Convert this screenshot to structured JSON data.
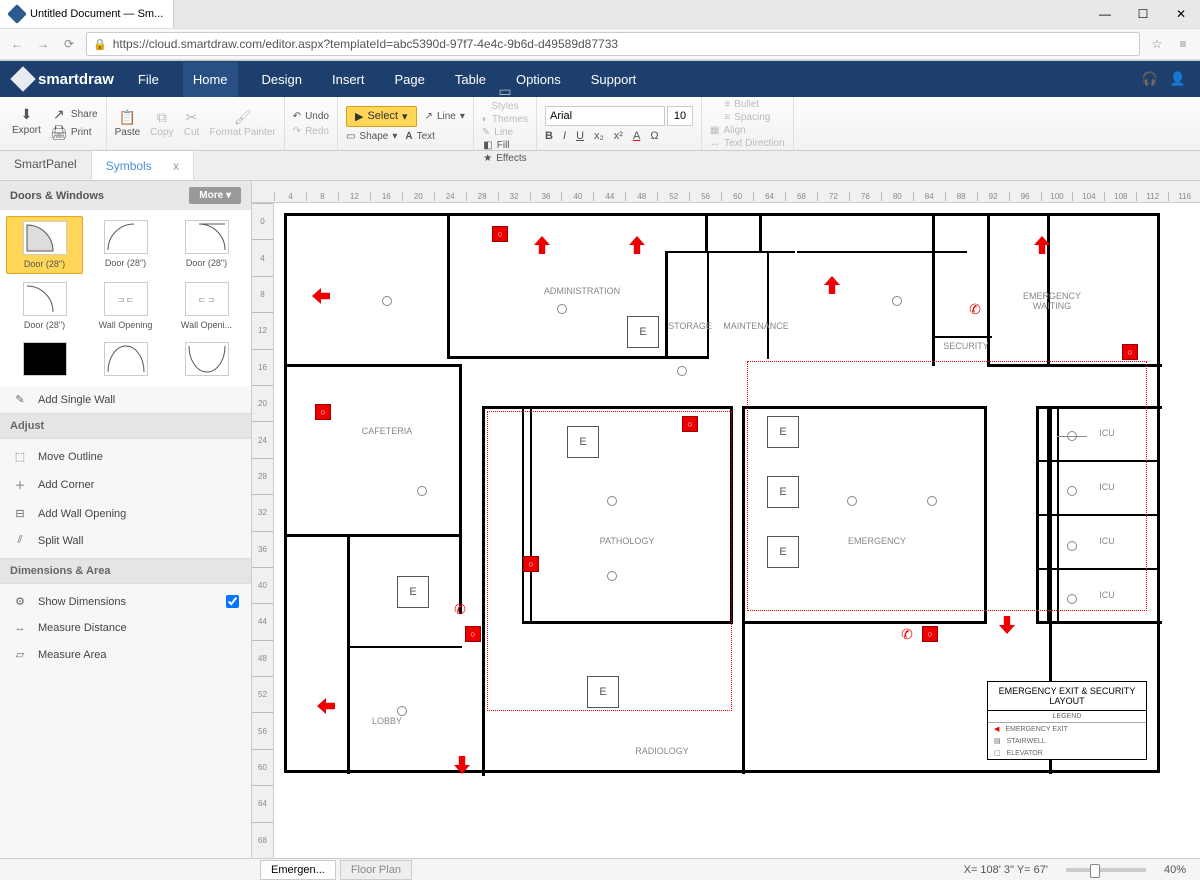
{
  "browser": {
    "tab_title": "Untitled Document — Sm...",
    "url": "https://cloud.smartdraw.com/editor.aspx?templateId=abc5390d-97f7-4e4c-9b6d-d49589d87733"
  },
  "window_controls": {
    "min": "—",
    "max": "☐",
    "close": "✕"
  },
  "app": {
    "brand": "smartdraw"
  },
  "menubar": [
    "File",
    "Home",
    "Design",
    "Insert",
    "Page",
    "Table",
    "Options",
    "Support"
  ],
  "menubar_active": "Home",
  "ribbon": {
    "export": "Export",
    "share": "Share",
    "print": "Print",
    "paste": "Paste",
    "copy": "Copy",
    "cut": "Cut",
    "format_painter": "Format Painter",
    "undo": "Undo",
    "redo": "Redo",
    "select": "Select",
    "line": "Line",
    "shape": "Shape",
    "text": "Text",
    "styles": "Styles",
    "themes": "Themes",
    "line2": "Line",
    "fill": "Fill",
    "effects": "Effects",
    "font_name": "Arial",
    "font_size": "10",
    "bold": "B",
    "italic": "I",
    "underline": "U",
    "sub": "x₂",
    "sup": "x²",
    "color": "A",
    "omega": "Ω",
    "bullet": "Bullet",
    "spacing": "Spacing",
    "align": "Align",
    "text_dir": "Text Direction"
  },
  "side_tabs": {
    "smartpanel": "SmartPanel",
    "symbols": "Symbols",
    "close": "x"
  },
  "panel": {
    "section1": "Doors & Windows",
    "more": "More ▾",
    "symbols": [
      {
        "label": "Door (28\")",
        "selected": true,
        "type": "arc"
      },
      {
        "label": "Door (28\")",
        "type": "arc2"
      },
      {
        "label": "Door (28\")",
        "type": "arc3"
      },
      {
        "label": "Door (28\")",
        "type": "arc4"
      },
      {
        "label": "Wall Opening",
        "type": "opening"
      },
      {
        "label": "Wall Openi...",
        "type": "opening2"
      },
      {
        "label": "",
        "type": "solid"
      },
      {
        "label": "",
        "type": "double1"
      },
      {
        "label": "",
        "type": "double2"
      }
    ],
    "add_single_wall": "Add Single Wall",
    "adjust_title": "Adjust",
    "adjust_items": [
      "Move Outline",
      "Add Corner",
      "Add Wall Opening",
      "Split Wall"
    ],
    "dims_title": "Dimensions & Area",
    "show_dims": "Show Dimensions",
    "measure_dist": "Measure Distance",
    "measure_area": "Measure Area"
  },
  "ruler_h": [
    "4",
    "8",
    "12",
    "16",
    "20",
    "24",
    "28",
    "32",
    "36",
    "40",
    "44",
    "48",
    "52",
    "56",
    "60",
    "64",
    "68",
    "72",
    "76",
    "80",
    "84",
    "88",
    "92",
    "96",
    "100",
    "104",
    "108",
    "112",
    "116"
  ],
  "ruler_v": [
    "0",
    "4",
    "8",
    "12",
    "16",
    "20",
    "24",
    "28",
    "32",
    "36",
    "40",
    "44",
    "48",
    "52",
    "56",
    "60",
    "64",
    "68"
  ],
  "floorplan": {
    "rooms": {
      "administration": "ADMINISTRATION",
      "storage": "STORAGE",
      "maintenance": "MAINTENANCE",
      "security": "SECURITY",
      "emergency_waiting": "EMERGENCY WAITING",
      "cafeteria": "CAFETERIA",
      "pathology": "PATHOLOGY",
      "emergency": "EMERGENCY",
      "icu1": "ICU",
      "icu2": "ICU",
      "icu3": "ICU",
      "icu4": "ICU",
      "lobby": "LOBBY",
      "radiology": "RADIOLOGY"
    },
    "elevator_label": "E",
    "legend": {
      "title": "EMERGENCY EXIT & SECURITY LAYOUT",
      "sub": "LEGEND",
      "emergency_exit": "EMERGENCY EXIT",
      "stairwell": "STAIRWELL",
      "elevator": "ELEVATOR"
    }
  },
  "doc_tabs": {
    "t1": "Emergen...",
    "t2": "Floor Plan"
  },
  "status": {
    "coords": "X= 108' 3\" Y= 67'",
    "zoom": "40%"
  }
}
